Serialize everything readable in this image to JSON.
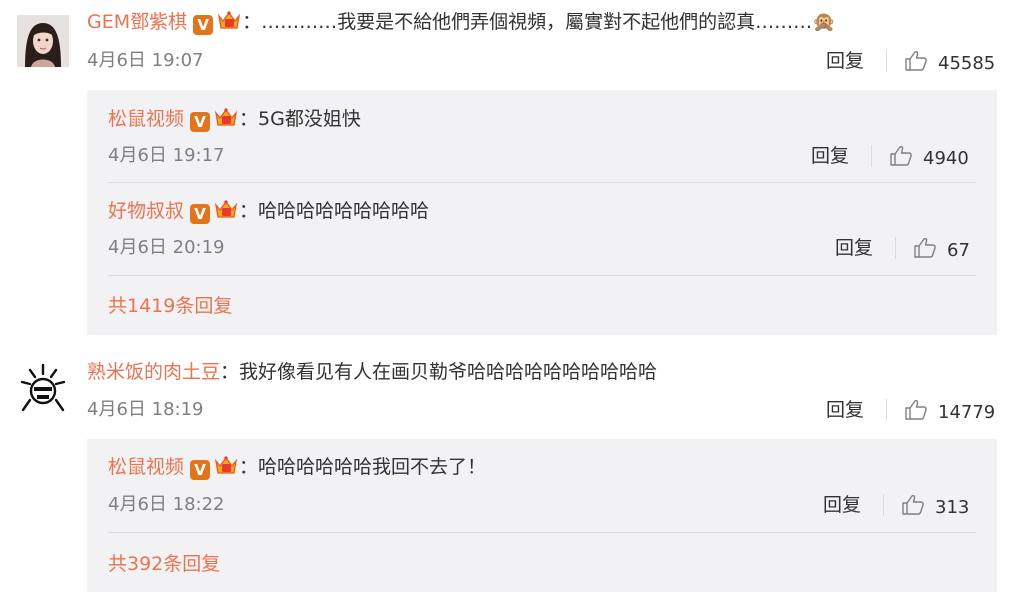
{
  "comments": [
    {
      "user": "GEM鄧紫棋",
      "text": "…………我要是不給他們弄個視頻，屬實對不起他們的認真………🙊",
      "time": "4月6日 19:07",
      "reply_label": "回复",
      "likes": "45585",
      "replies": [
        {
          "user": "松鼠视频",
          "text": "5G都没姐快",
          "time": "4月6日 19:17",
          "reply_label": "回复",
          "likes": "4940"
        },
        {
          "user": "好物叔叔",
          "text": "哈哈哈哈哈哈哈哈哈",
          "time": "4月6日 20:19",
          "reply_label": "回复",
          "likes": "67"
        }
      ],
      "more_replies": "共1419条回复"
    },
    {
      "user": "熟米饭的肉土豆",
      "text": "我好像看见有人在画贝勒爷哈哈哈哈哈哈哈哈哈哈",
      "time": "4月6日 18:19",
      "reply_label": "回复",
      "likes": "14779",
      "replies": [
        {
          "user": "松鼠视频",
          "text": "哈哈哈哈哈哈我回不去了！",
          "time": "4月6日 18:22",
          "reply_label": "回复",
          "likes": "313"
        }
      ],
      "more_replies": "共392条回复"
    }
  ],
  "separator": "：",
  "badge_v": "V",
  "icons": [
    "like-icon",
    "verified-v-icon",
    "crown-badge-icon"
  ],
  "colors": {
    "username": "#eb7350",
    "badge": "#e2751b",
    "sub_bg": "#f2f2f5"
  }
}
